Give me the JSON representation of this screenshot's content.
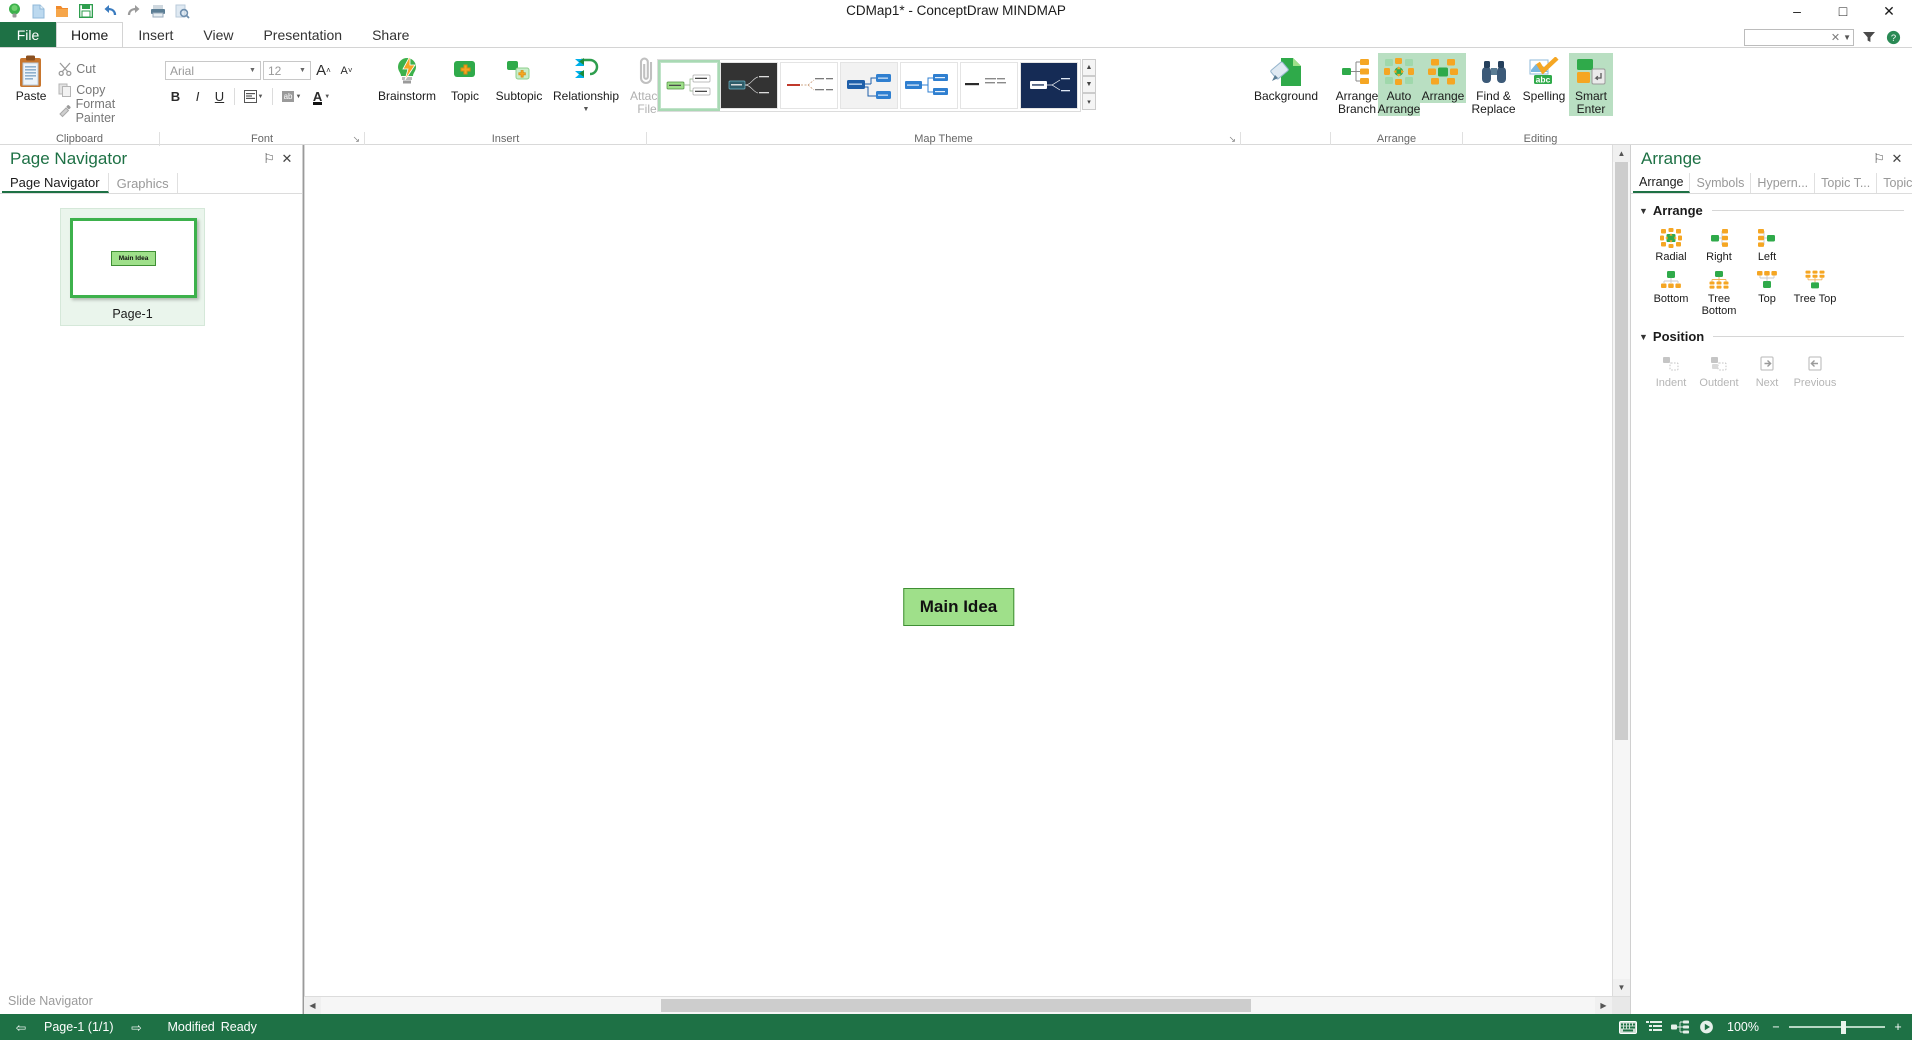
{
  "window": {
    "title": "CDMap1* - ConceptDraw MINDMAP",
    "minimize": "–",
    "maximize": "□",
    "close": "✕"
  },
  "quick_access": [
    {
      "name": "conceptdraw-logo-icon",
      "label": "ConceptDraw"
    },
    {
      "name": "new-document-icon",
      "label": "New"
    },
    {
      "name": "open-folder-icon",
      "label": "Open"
    },
    {
      "name": "save-icon",
      "label": "Save"
    },
    {
      "name": "undo-icon",
      "label": "Undo"
    },
    {
      "name": "redo-icon",
      "label": "Redo"
    },
    {
      "name": "print-icon",
      "label": "Print"
    },
    {
      "name": "print-preview-icon",
      "label": "Print Preview"
    }
  ],
  "tabs": {
    "file": "File",
    "items": [
      {
        "label": "Home",
        "active": true
      },
      {
        "label": "Insert",
        "active": false
      },
      {
        "label": "View",
        "active": false
      },
      {
        "label": "Presentation",
        "active": false
      },
      {
        "label": "Share",
        "active": false
      }
    ]
  },
  "search": {
    "value": "",
    "placeholder": "",
    "clear": "✕",
    "caret": "▼",
    "filter_icon": "filter-icon",
    "help_icon": "help-icon"
  },
  "ribbon": {
    "clipboard": {
      "group_label": "Clipboard",
      "paste": "Paste",
      "cut": "Cut",
      "copy": "Copy",
      "format_painter": "Format Painter"
    },
    "font": {
      "group_label": "Font",
      "family": "Arial",
      "size": "12",
      "grow": "A",
      "shrink": "A",
      "bold": "B",
      "italic": "I",
      "underline": "U",
      "align": "align-icon",
      "highlight": "ab",
      "font_color": "A",
      "dialog_launcher": "↘"
    },
    "insert": {
      "group_label": "Insert",
      "brainstorm": "Brainstorm",
      "topic": "Topic",
      "subtopic": "Subtopic",
      "relationship": "Relationship",
      "attach_file_l1": "Attach",
      "attach_file_l2": "File"
    },
    "map_theme": {
      "group_label": "Map Theme",
      "dialog_launcher": "↘",
      "scroll_up": "▲",
      "scroll_down": "▼",
      "scroll_more": "▾",
      "themes": [
        {
          "name": "theme-green-light",
          "selected": true,
          "bg": "#ffffff",
          "node": "#9fe08a",
          "line": "#7aa870",
          "leaf": "#ffffff"
        },
        {
          "name": "theme-dark-charcoal",
          "selected": false,
          "bg": "#333333",
          "node": "#3f6f7a",
          "line": "#cfcfcf",
          "leaf": "#333333"
        },
        {
          "name": "theme-white-plain",
          "selected": false,
          "bg": "#ffffff",
          "node": "#ffffff",
          "line": "#c08a60",
          "leaf": "#ffffff"
        },
        {
          "name": "theme-blue-boxes",
          "selected": false,
          "bg": "#f2f2f2",
          "node": "#1f5fa9",
          "line": "#1f5fa9",
          "leaf": "#2f7fd0"
        },
        {
          "name": "theme-blue-flat",
          "selected": false,
          "bg": "#ffffff",
          "node": "#2f7fd0",
          "line": "#2f7fd0",
          "leaf": "#2f7fd0"
        },
        {
          "name": "theme-plain-text",
          "selected": false,
          "bg": "#ffffff",
          "node": "#ffffff",
          "line": "#999999",
          "leaf": "#ffffff"
        },
        {
          "name": "theme-navy-dark",
          "selected": false,
          "bg": "#152b55",
          "node": "#ffffff",
          "line": "#ffffff",
          "leaf": "#152b55"
        }
      ]
    },
    "background": {
      "group_label": "",
      "label": "Background"
    },
    "arrange": {
      "group_label": "Arrange",
      "arrange_branch_l1": "Arrange",
      "arrange_branch_l2": "Branch",
      "auto_arrange_l1": "Auto",
      "auto_arrange_l2": "Arrange",
      "arrange": "Arrange"
    },
    "editing": {
      "group_label": "Editing",
      "find_replace_l1": "Find &",
      "find_replace_l2": "Replace",
      "spelling": "Spelling",
      "smart_enter_l1": "Smart",
      "smart_enter_l2": "Enter"
    }
  },
  "left_panel": {
    "title": "Page Navigator",
    "pin": "⚐",
    "close": "✕",
    "tabs": [
      {
        "label": "Page Navigator",
        "active": true
      },
      {
        "label": "Graphics",
        "active": false
      }
    ],
    "page": {
      "caption": "Page-1",
      "node_label": "Main Idea"
    },
    "slide_navigator": "Slide Navigator"
  },
  "canvas": {
    "main_idea": "Main Idea",
    "scroll_up": "▲",
    "scroll_down": "▼",
    "scroll_left": "◀",
    "scroll_right": "▶"
  },
  "right_panel": {
    "title": "Arrange",
    "pin": "⚐",
    "close": "✕",
    "tabs": [
      {
        "label": "Arrange",
        "active": true
      },
      {
        "label": "Symbols",
        "active": false
      },
      {
        "label": "Hypern...",
        "active": false
      },
      {
        "label": "Topic T...",
        "active": false
      },
      {
        "label": "Topic D...",
        "active": false
      }
    ],
    "sections": [
      {
        "name": "arrange",
        "title": "Arrange",
        "collapse": "▼",
        "items": [
          {
            "label": "Radial",
            "icon": "arrange-radial-icon",
            "disabled": false
          },
          {
            "label": "Right",
            "icon": "arrange-right-icon",
            "disabled": false
          },
          {
            "label": "Left",
            "icon": "arrange-left-icon",
            "disabled": false
          },
          {
            "label": "Bottom",
            "icon": "arrange-bottom-icon",
            "disabled": false
          },
          {
            "label": "Tree Bottom",
            "icon": "arrange-tree-bottom-icon",
            "disabled": false
          },
          {
            "label": "Top",
            "icon": "arrange-top-icon",
            "disabled": false
          },
          {
            "label": "Tree Top",
            "icon": "arrange-tree-top-icon",
            "disabled": false
          }
        ]
      },
      {
        "name": "position",
        "title": "Position",
        "collapse": "▼",
        "items": [
          {
            "label": "Indent",
            "icon": "indent-icon",
            "disabled": true
          },
          {
            "label": "Outdent",
            "icon": "outdent-icon",
            "disabled": true
          },
          {
            "label": "Next",
            "icon": "next-icon",
            "disabled": true
          },
          {
            "label": "Previous",
            "icon": "previous-icon",
            "disabled": true
          }
        ]
      }
    ]
  },
  "status_bar": {
    "prev_page": "⇦",
    "next_page": "⇨",
    "page_indicator": "Page-1 (1/1)",
    "modified": "Modified",
    "ready": "Ready",
    "view_icons": [
      "keyboard-icon",
      "outline-view-icon",
      "mindmap-view-icon",
      "presentation-play-icon"
    ],
    "zoom_level": "100%",
    "zoom_out": "−",
    "zoom_in": "+"
  },
  "colors": {
    "accent_green": "#1e7145",
    "node_green": "#9fe08a",
    "ribbon_highlight": "#b9dfc2",
    "orange": "#f2a33c"
  }
}
